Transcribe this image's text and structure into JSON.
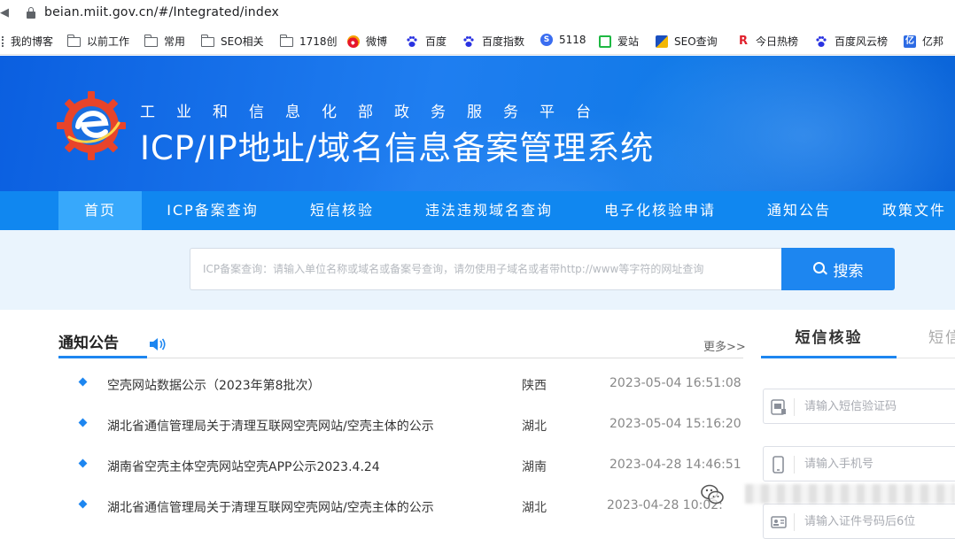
{
  "browser": {
    "url": "beian.miit.gov.cn/#/Integrated/index",
    "edge_char": "◀",
    "bookmarks": [
      {
        "label": "我的博客",
        "icon": "grid-icon"
      },
      {
        "label": "以前工作",
        "icon": "folder-icon"
      },
      {
        "label": "常用",
        "icon": "folder-icon"
      },
      {
        "label": "SEO相关",
        "icon": "folder-icon"
      },
      {
        "label": "1718创",
        "icon": "folder-icon"
      },
      {
        "label": "微博",
        "icon": "weibo-icon"
      },
      {
        "label": "百度",
        "icon": "baidu-paw-icon"
      },
      {
        "label": "百度指数",
        "icon": "baidu-paw-icon"
      },
      {
        "label": "5118",
        "icon": "5118-icon"
      },
      {
        "label": "爱站",
        "icon": "aizhan-icon"
      },
      {
        "label": "SEO查询",
        "icon": "seo-query-icon"
      },
      {
        "label": "今日热榜",
        "icon": "r-icon"
      },
      {
        "label": "百度风云榜",
        "icon": "baidu-paw-icon"
      },
      {
        "label": "亿邦",
        "icon": "yibang-icon"
      }
    ]
  },
  "header": {
    "subtitle": "工业和信息化部政务服务平台",
    "title": "ICP/IP地址/域名信息备案管理系统",
    "colors": {
      "banner": "#1f7ef0",
      "nav": "#1087f0",
      "nav_active": "#37a8fb"
    }
  },
  "nav": {
    "items": [
      {
        "label": "首页",
        "active": true
      },
      {
        "label": "ICP备案查询"
      },
      {
        "label": "短信核验"
      },
      {
        "label": "违法违规域名查询"
      },
      {
        "label": "电子化核验申请"
      },
      {
        "label": "通知公告"
      },
      {
        "label": "政策文件"
      }
    ]
  },
  "search": {
    "placeholder": "ICP备案查询：请输入单位名称或域名或备案号查询，请勿使用子域名或者带http://www等字符的网址查询",
    "button_label": "搜索"
  },
  "notices": {
    "title": "通知公告",
    "more_label": "更多>>",
    "rows": [
      {
        "name": "空壳网站数据公示（2023年第8批次）",
        "province": "陕西",
        "time": "2023-05-04 16:51:08"
      },
      {
        "name": "湖北省通信管理局关于清理互联网空壳网站/空壳主体的公示",
        "province": "湖北",
        "time": "2023-05-04 15:16:20"
      },
      {
        "name": "湖南省空壳主体空壳网站空壳APP公示2023.4.24",
        "province": "湖南",
        "time": "2023-04-28 14:46:51"
      },
      {
        "name": "湖北省通信管理局关于清理互联网空壳网站/空壳主体的公示",
        "province": "湖北",
        "time": "2023-04-28 10:02:"
      }
    ]
  },
  "verify": {
    "tab_active": "短信核验",
    "tab_other": "短信",
    "fields": [
      {
        "placeholder": "请输入短信验证码",
        "icon": "sms-code-icon"
      },
      {
        "placeholder": "请输入手机号",
        "icon": "phone-icon"
      },
      {
        "placeholder": "请输入证件号码后6位",
        "icon": "id-card-icon"
      }
    ]
  }
}
